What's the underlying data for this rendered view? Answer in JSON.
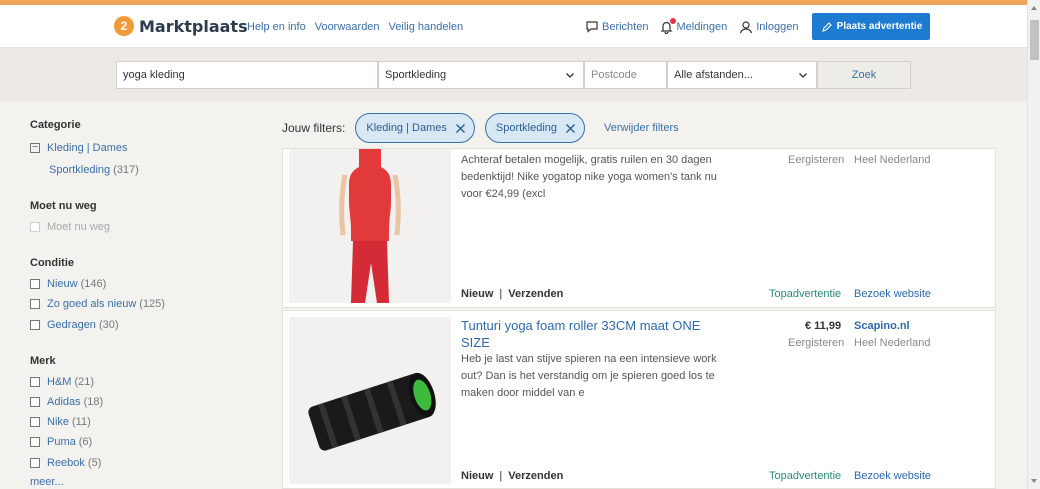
{
  "header": {
    "logo": "Marktplaats",
    "nav": [
      "Help en info",
      "Voorwaarden",
      "Veilig handelen"
    ],
    "messages_label": "Berichten",
    "notifications_label": "Meldingen",
    "login_label": "Inloggen",
    "place_ad_label": "Plaats advertentie",
    "accent_color": "#f0a45a",
    "brand_color": "#1d7bd0"
  },
  "search": {
    "query": "yoga kleding",
    "category": "Sportkleding",
    "postcode_placeholder": "Postcode",
    "distance": "Alle afstanden...",
    "submit_label": "Zoek"
  },
  "sidebar": {
    "categorie": {
      "title": "Categorie",
      "parent": "Kleding | Dames",
      "child": "Sportkleding",
      "child_count": "(317)"
    },
    "moet_nu_weg": {
      "title": "Moet nu weg",
      "option": "Moet nu weg"
    },
    "conditie": {
      "title": "Conditie",
      "options": [
        {
          "label": "Nieuw",
          "count": "(146)"
        },
        {
          "label": "Zo goed als nieuw",
          "count": "(125)"
        },
        {
          "label": "Gedragen",
          "count": "(30)"
        }
      ]
    },
    "merk": {
      "title": "Merk",
      "options": [
        {
          "label": "H&M",
          "count": "(21)"
        },
        {
          "label": "Adidas",
          "count": "(18)"
        },
        {
          "label": "Nike",
          "count": "(11)"
        },
        {
          "label": "Puma",
          "count": "(6)"
        },
        {
          "label": "Reebok",
          "count": "(5)"
        }
      ],
      "more": "meer..."
    }
  },
  "filters": {
    "label": "Jouw filters:",
    "chips": [
      "Kleding | Dames",
      "Sportkleding"
    ],
    "clear_label": "Verwijder filters"
  },
  "listings": [
    {
      "description": "Achteraf betalen mogelijk, gratis ruilen en 30 dagen bedenktijd! Nike yogatop nike yoga women's tank nu voor €24,99 (excl",
      "date": "Eergisteren",
      "location": "Heel Nederland",
      "tag1": "Nieuw",
      "tag2": "Verzenden",
      "promo": "Topadvertentie",
      "website": "Bezoek website",
      "image": "red-tank-top"
    },
    {
      "title": "Tunturi yoga foam roller 33CM maat ONE SIZE",
      "description": "Heb je last van stijve spieren na een intensieve work out? Dan is het verstandig om je spieren goed los te maken door middel van e",
      "price": "€ 11,99",
      "seller": "Scapino.nl",
      "date": "Eergisteren",
      "location": "Heel Nederland",
      "tag1": "Nieuw",
      "tag2": "Verzenden",
      "promo": "Topadvertentie",
      "website": "Bezoek website",
      "image": "foam-roller"
    }
  ]
}
